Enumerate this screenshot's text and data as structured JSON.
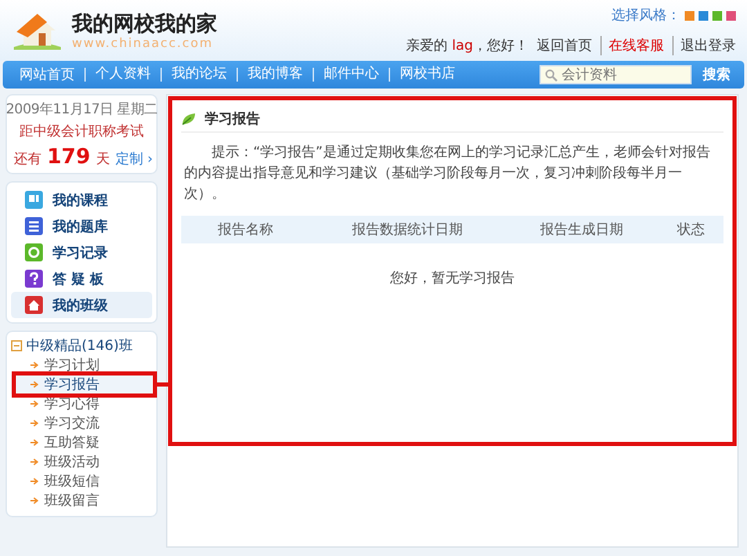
{
  "header": {
    "site_title": "我的网校我的家",
    "site_url": "www.chinaacc.com",
    "style_label": "选择风格：",
    "style_swatches": [
      {
        "color": "#f08a24"
      },
      {
        "color": "#2a8ad8"
      },
      {
        "color": "#5cb82a"
      },
      {
        "color": "#e0507a"
      }
    ],
    "greeting": {
      "prefix": "亲爱的",
      "user": "lag",
      "suffix": "，您好！"
    },
    "links": [
      {
        "label": "返回首页",
        "highlight": false
      },
      {
        "label": "在线客服",
        "highlight": true
      },
      {
        "label": "退出登录",
        "highlight": false
      }
    ]
  },
  "nav": {
    "items": [
      "网站首页",
      "个人资料",
      "我的论坛",
      "我的博客",
      "邮件中心",
      "网校书店"
    ],
    "search": {
      "placeholder": "会计资料",
      "button": "搜索"
    }
  },
  "sidebar": {
    "countdown": {
      "date": "2009年11月17日 星期二",
      "exam": "距中级会计职称考试",
      "prefix": "还有",
      "days": "179",
      "unit": "天",
      "link": "定制 ›"
    },
    "menu": [
      {
        "label": "我的课程",
        "kind": "course",
        "selected": false
      },
      {
        "label": "我的题库",
        "kind": "bank",
        "selected": false
      },
      {
        "label": "学习记录",
        "kind": "record",
        "selected": false
      },
      {
        "label": "答 疑 板",
        "kind": "qa",
        "selected": false
      },
      {
        "label": "我的班级",
        "kind": "class",
        "selected": true
      }
    ],
    "classes": [
      {
        "label": "中级精品(146)班",
        "expanded": true,
        "children": [
          {
            "label": "学习计划",
            "selected": false
          },
          {
            "label": "学习报告",
            "selected": true
          },
          {
            "label": "学习心得",
            "selected": false
          },
          {
            "label": "学习交流",
            "selected": false
          },
          {
            "label": "互助答疑",
            "selected": false
          },
          {
            "label": "班级活动",
            "selected": false
          },
          {
            "label": "班级短信",
            "selected": false
          },
          {
            "label": "班级留言",
            "selected": false
          }
        ]
      }
    ]
  },
  "main": {
    "title": "学习报告",
    "hint": "提示：“学习报告”是通过定期收集您在网上的学习记录汇总产生，老师会针对报告的内容提出指导意见和学习建议（基础学习阶段每月一次，复习冲刺阶段每半月一次）。",
    "table": {
      "columns": [
        "报告名称",
        "报告数据统计日期",
        "报告生成日期",
        "状态"
      ],
      "empty_message": "您好，暂无学习报告"
    }
  }
}
